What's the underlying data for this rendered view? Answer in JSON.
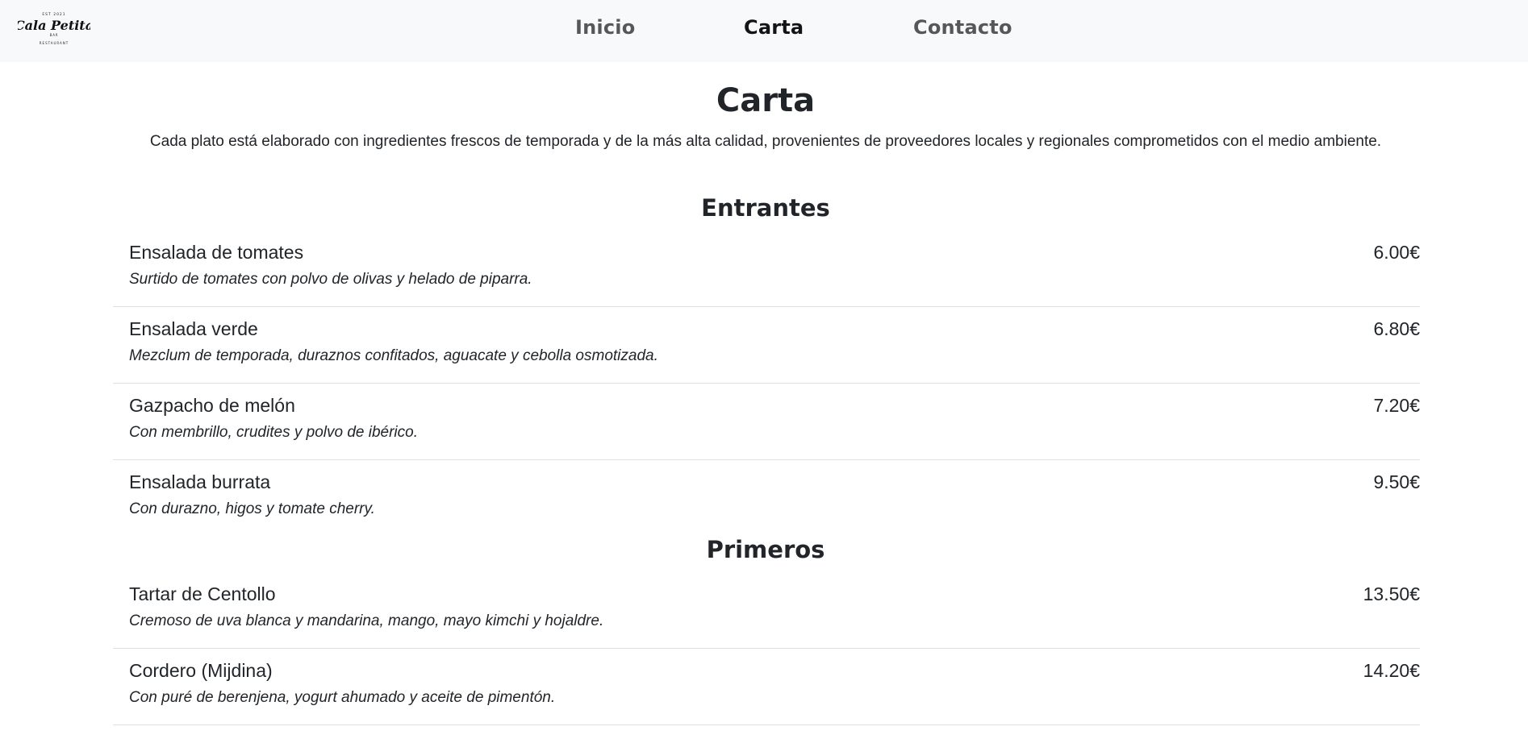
{
  "brand": {
    "logo_text": "Cala Petita",
    "logo_top_text": "EST 2021",
    "logo_mid_text": "BAR",
    "logo_bottom_text": "RESTAURANT"
  },
  "nav": {
    "items": [
      {
        "label": "Inicio"
      },
      {
        "label": "Carta"
      },
      {
        "label": "Contacto"
      }
    ],
    "active": "Carta"
  },
  "page": {
    "title": "Carta",
    "intro": "Cada plato está elaborado con ingredientes frescos de temporada y de la más alta calidad, provenientes de proveedores locales y regionales comprometidos con el medio ambiente."
  },
  "sections": [
    {
      "title": "Entrantes",
      "items": [
        {
          "name": "Ensalada de tomates",
          "description": "Surtido de tomates con polvo de olivas y helado de piparra.",
          "price": "6.00€"
        },
        {
          "name": "Ensalada verde",
          "description": "Mezclum de temporada, duraznos confitados, aguacate y cebolla osmotizada.",
          "price": "6.80€"
        },
        {
          "name": "Gazpacho de melón",
          "description": "Con membrillo, crudites y polvo de ibérico.",
          "price": "7.20€"
        },
        {
          "name": "Ensalada burrata",
          "description": "Con durazno, higos y tomate cherry.",
          "price": "9.50€"
        }
      ]
    },
    {
      "title": "Primeros",
      "items": [
        {
          "name": "Tartar de Centollo",
          "description": "Cremoso de uva blanca y mandarina, mango, mayo kimchi y hojaldre.",
          "price": "13.50€"
        },
        {
          "name": "Cordero (Mijdina)",
          "description": "Con puré de berenjena, yogurt ahumado y aceite de pimentón.",
          "price": "14.20€"
        }
      ]
    }
  ],
  "colors": {
    "navbar_bg": "#f8f9fa",
    "text": "#212529",
    "divider": "#dee2e6"
  }
}
